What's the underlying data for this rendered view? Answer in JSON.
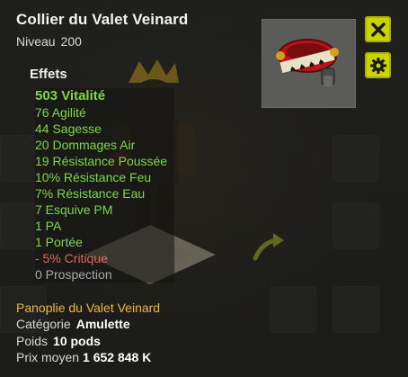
{
  "item": {
    "name": "Collier du Valet Veinard",
    "level_label": "Niveau",
    "level_value": "200"
  },
  "effects": {
    "title": "Effets",
    "lines": [
      {
        "text": "503 Vitalité",
        "color": "#7fd64a"
      },
      {
        "text": "76 Agilité",
        "color": "#7fd64a"
      },
      {
        "text": "44 Sagesse",
        "color": "#7fd64a"
      },
      {
        "text": "20 Dommages Air",
        "color": "#7fd64a"
      },
      {
        "text": "19 Résistance Poussée",
        "color": "#7fd64a"
      },
      {
        "text": "10% Résistance Feu",
        "color": "#7fd64a"
      },
      {
        "text": "7% Résistance Eau",
        "color": "#7fd64a"
      },
      {
        "text": "7 Esquive PM",
        "color": "#7fd64a"
      },
      {
        "text": "1 PA",
        "color": "#7fd64a"
      },
      {
        "text": "1 Portée",
        "color": "#7fd64a"
      },
      {
        "text": "- 5% Critique",
        "color": "#e06a55"
      },
      {
        "text": "0 Prospection",
        "color": "#a8a8a8"
      }
    ]
  },
  "set": {
    "name": "Panoplie du Valet Veinard"
  },
  "info": {
    "category_label": "Catégorie",
    "category_value": "Amulette",
    "weight_label": "Poids",
    "weight_value": "10 pods",
    "price_label": "Prix moyen",
    "price_value": "1 652 848 K"
  },
  "buttons": {
    "close_icon": "close-icon",
    "settings_icon": "gear-icon"
  },
  "colors": {
    "accent": "#c9d400",
    "bonus": "#7fd64a",
    "malus": "#e06a55",
    "set_name": "#f0b83a"
  }
}
